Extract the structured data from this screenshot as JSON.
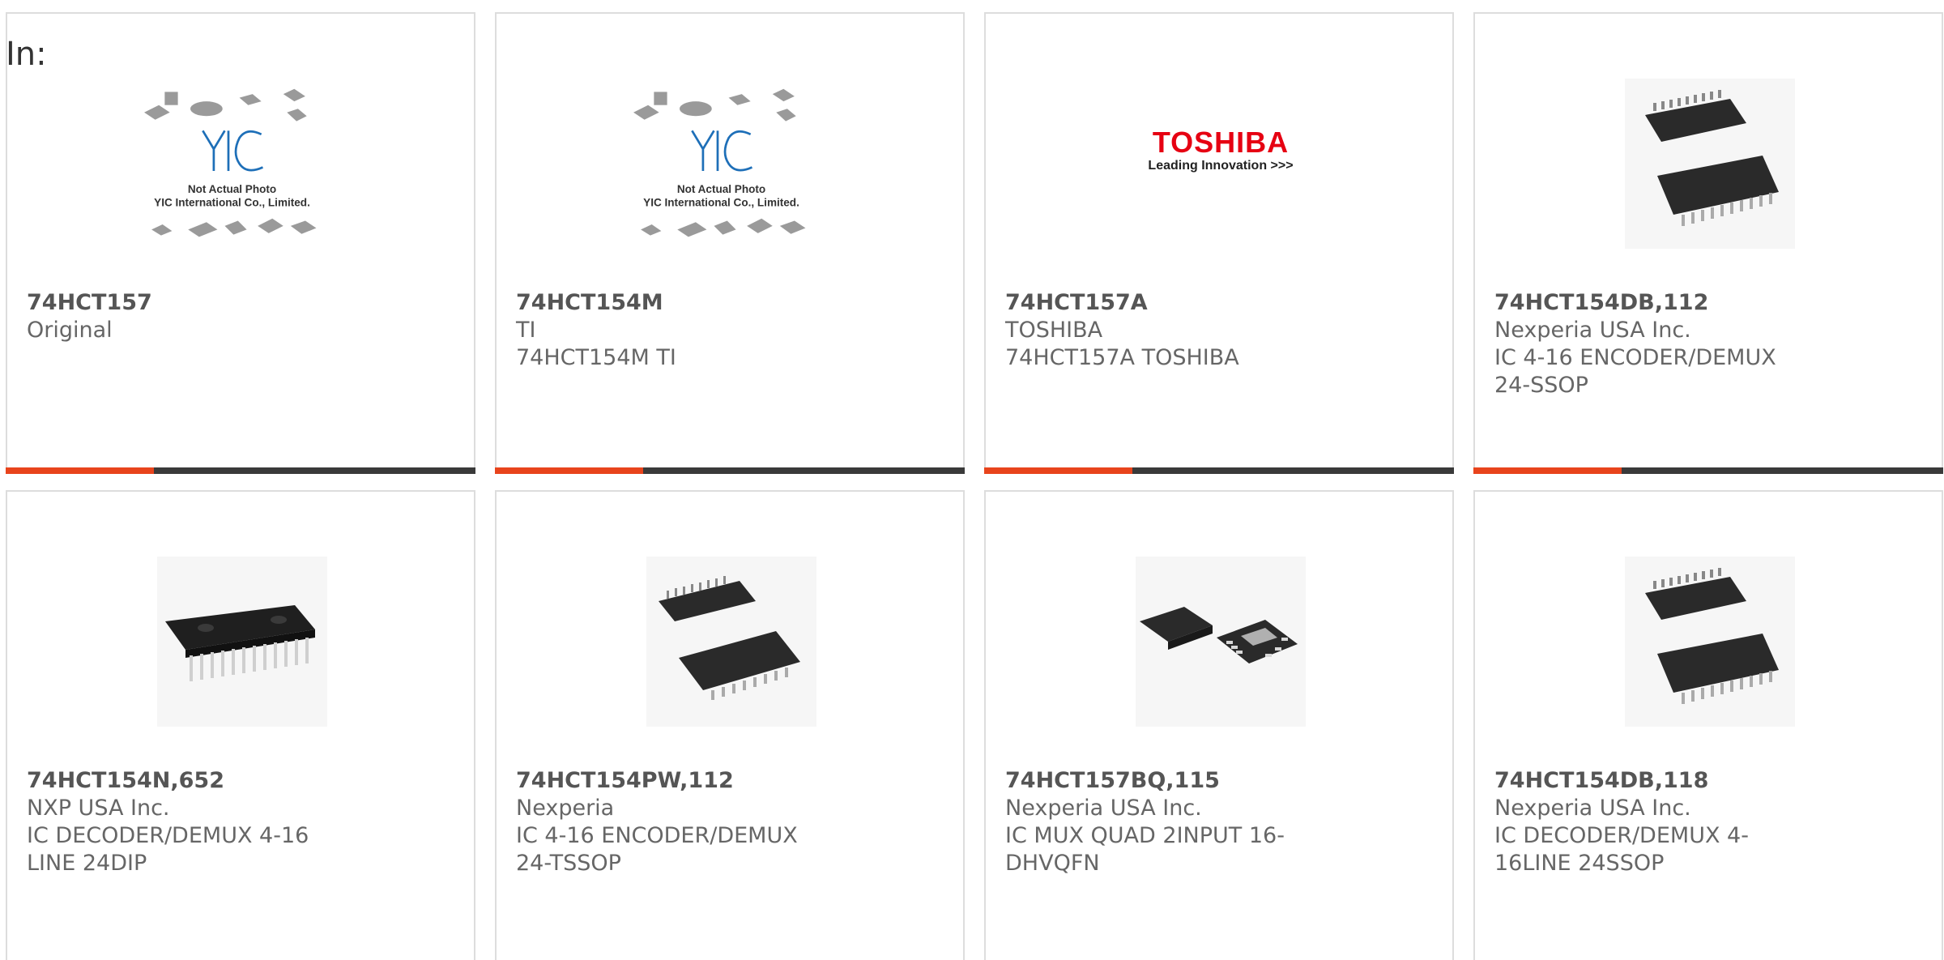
{
  "filter_label": "In:",
  "accent_color": "#e8441c",
  "bar_color": "#3a3a3a",
  "placeholder_photo": {
    "logo_text": "YIC",
    "note_line1": "Not Actual Photo",
    "note_line2": "YIC International Co., Limited."
  },
  "toshiba_logo": {
    "word": "TOSHIBA",
    "tagline": "Leading Innovation >>>"
  },
  "products": [
    {
      "part": "74HCT157",
      "maker": "Original",
      "desc": "",
      "image": "yic-placeholder"
    },
    {
      "part": "74HCT154M",
      "maker": "TI",
      "desc": "74HCT154M TI",
      "image": "yic-placeholder"
    },
    {
      "part": "74HCT157A",
      "maker": "TOSHIBA",
      "desc": "74HCT157A TOSHIBA",
      "image": "toshiba-logo"
    },
    {
      "part": "74HCT154DB,112",
      "maker": "Nexperia USA Inc.",
      "desc": "IC 4-16 ENCODER/DEMUX 24-SSOP",
      "image": "ssop-chip"
    },
    {
      "part": "74HCT154N,652",
      "maker": "NXP USA Inc.",
      "desc": "IC DECODER/DEMUX 4-16 LINE 24DIP",
      "image": "dip-chip"
    },
    {
      "part": "74HCT154PW,112",
      "maker": "Nexperia",
      "desc": "IC 4-16 ENCODER/DEMUX 24-TSSOP",
      "image": "tssop-chip"
    },
    {
      "part": "74HCT157BQ,115",
      "maker": "Nexperia USA Inc.",
      "desc": "IC MUX QUAD 2INPUT 16-DHVQFN",
      "image": "qfn-chip"
    },
    {
      "part": "74HCT154DB,118",
      "maker": "Nexperia USA Inc.",
      "desc": "IC DECODER/DEMUX 4-16LINE 24SSOP",
      "image": "ssop-chip"
    }
  ]
}
